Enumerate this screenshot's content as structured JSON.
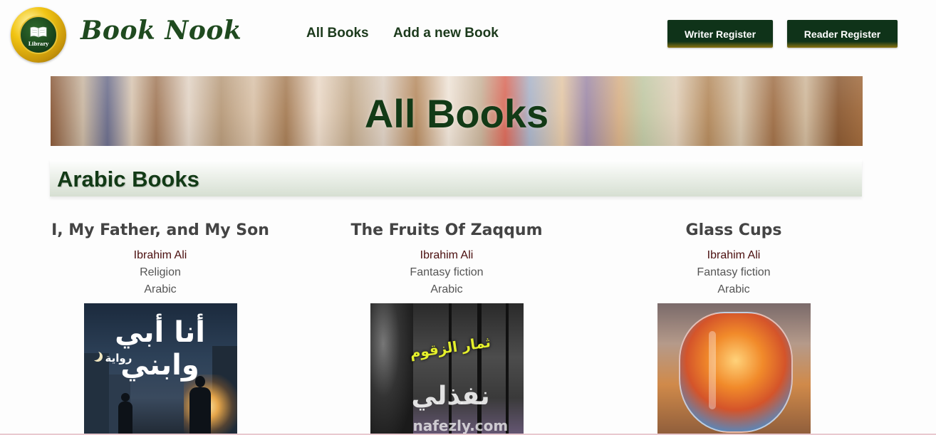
{
  "header": {
    "logo_text": "Library",
    "brand": "Book Nook",
    "nav": {
      "all_books": "All Books",
      "add_book": "Add a new Book"
    },
    "buttons": {
      "writer_register": "Writer Register",
      "reader_register": "Reader Register"
    }
  },
  "banner": {
    "title": "All Books"
  },
  "section": {
    "title": "Arabic Books"
  },
  "books": [
    {
      "title": "I, My Father, and My Son",
      "author": "Ibrahim Ali",
      "genre": "Religion",
      "language": "Arabic",
      "cover_text": "أنا أبي وابني",
      "cover_subtext": "رواية"
    },
    {
      "title": "The Fruits Of Zaqqum",
      "author": "Ibrahim Ali",
      "genre": "Fantasy fiction",
      "language": "Arabic",
      "cover_text": "ثمار الزقوم",
      "watermark": "نفذلي",
      "watermark_url": "nafezly.com"
    },
    {
      "title": "Glass Cups",
      "author": "Ibrahim Ali",
      "genre": "Fantasy fiction",
      "language": "Arabic"
    }
  ],
  "colors": {
    "brand_green": "#123a16",
    "button_bg": "#0f3319",
    "author_color": "#4a0e0e"
  }
}
